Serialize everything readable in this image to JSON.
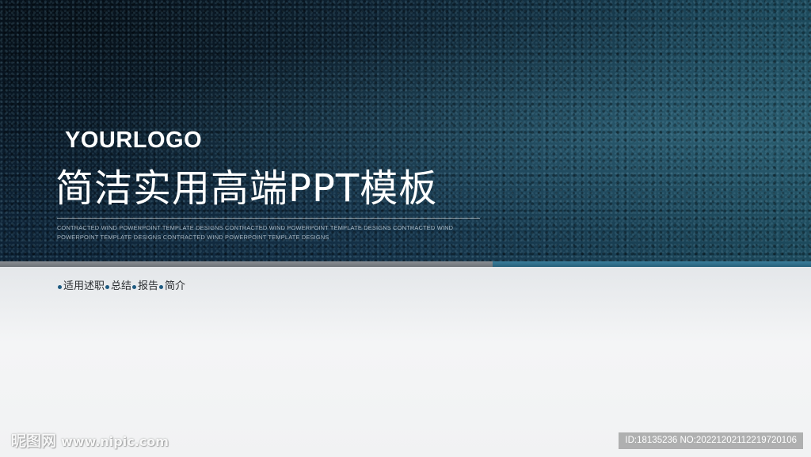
{
  "slide": {
    "logo": "YOURLOGO",
    "title": "简洁实用高端PPT模板",
    "subtitle": "CONTRACTED WIND POWERPOINT TEMPLATE DESIGNS CONTRACTED WIND POWERPOINT TEMPLATE DESIGNS CONTRACTED WIND POWERPOINT TEMPLATE DESIGNS CONTRACTED WIND POWERPOINT TEMPLATE DESIGNS",
    "tags": [
      "适用述职",
      "总结",
      "报告",
      "简介"
    ]
  },
  "watermark": {
    "site_name": "昵图网",
    "site_url": "www.nipic.com",
    "image_id": "ID:18135236 NO:20221202112219720106"
  },
  "colors": {
    "banner_dark": "#0d2235",
    "banner_light": "#1d4a5c",
    "divider_gray": "#7a8085",
    "divider_blue": "#2f6f8c",
    "bullet": "#1e5a80",
    "lower_bg": "#f1f2f3"
  }
}
